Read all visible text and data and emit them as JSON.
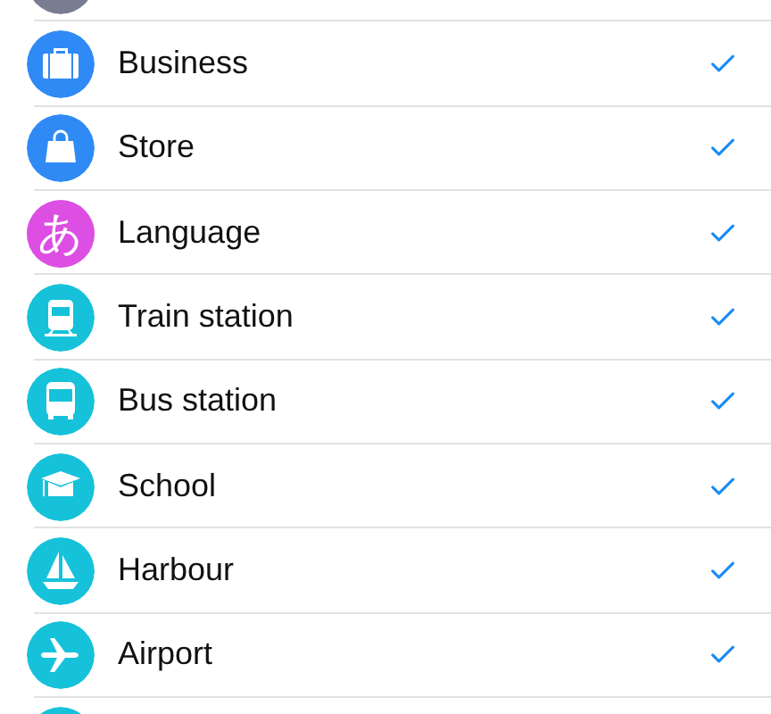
{
  "items": [
    {
      "kind": "blank",
      "color": "#7a7d92"
    },
    {
      "kind": "briefcase",
      "color": "#2f8af5",
      "label": "Business",
      "checked": true
    },
    {
      "kind": "bag",
      "color": "#2f8af5",
      "label": "Store",
      "checked": true
    },
    {
      "kind": "glyph",
      "glyph": "あ",
      "color": "#dc4fe2",
      "label": "Language",
      "checked": true
    },
    {
      "kind": "train",
      "color": "#16c2da",
      "label": "Train station",
      "checked": true
    },
    {
      "kind": "bus",
      "color": "#16c2da",
      "label": "Bus station",
      "checked": true
    },
    {
      "kind": "school",
      "color": "#16c2da",
      "label": "School",
      "checked": true
    },
    {
      "kind": "boat",
      "color": "#16c2da",
      "label": "Harbour",
      "checked": true
    },
    {
      "kind": "plane",
      "color": "#16c2da",
      "label": "Airport",
      "checked": true
    },
    {
      "kind": "blank",
      "color": "#16c2da"
    }
  ]
}
